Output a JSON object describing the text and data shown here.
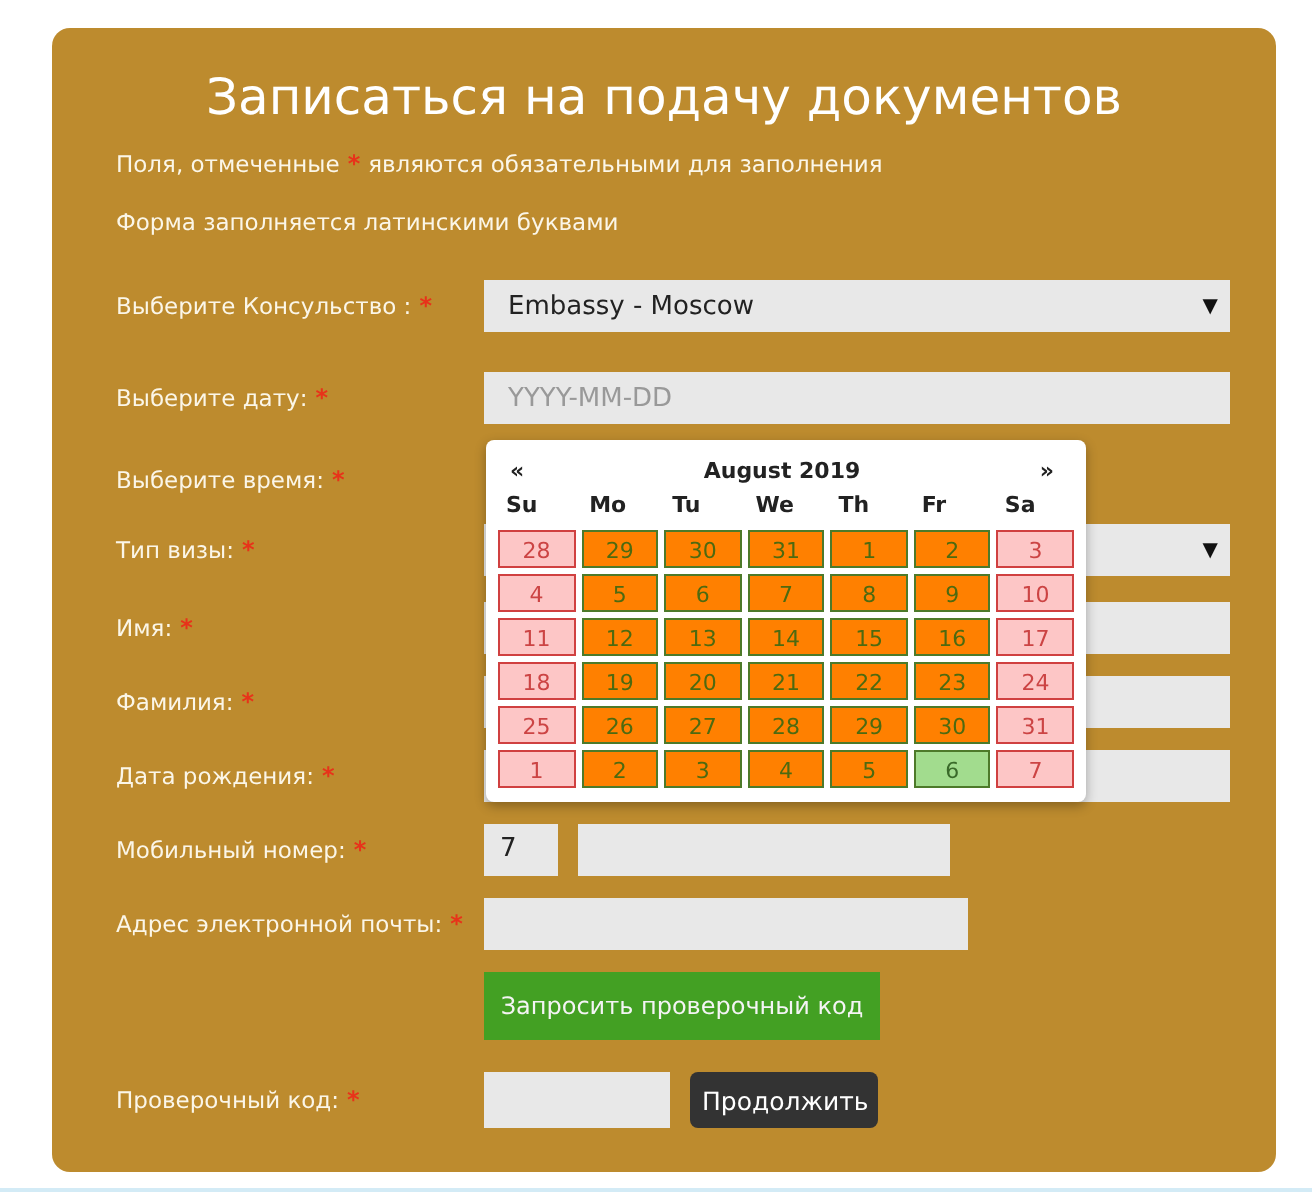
{
  "title": "Записаться на подачу документов",
  "required_mark": "*",
  "notes": [
    {
      "before": "Поля, отмеченные",
      "required": true,
      "after": "являются обязательными для заполнения"
    },
    {
      "before": "Форма заполняется латинскими буквами",
      "required": false
    }
  ],
  "fields": [
    {
      "label": "Выберите Консульство :",
      "required": true,
      "kind": "select",
      "value": "Embassy - Moscow",
      "arrow": "▼"
    },
    {
      "label": "Выберите дату:",
      "required": true,
      "kind": "date",
      "placeholder": "YYYY-MM-DD"
    },
    {
      "label": "Выберите время:",
      "required": true,
      "kind": "covered"
    },
    {
      "label": "Тип визы:",
      "required": true,
      "kind": "select",
      "arrow": "▼"
    },
    {
      "label": "Имя:",
      "required": true,
      "kind": "text"
    },
    {
      "label": "Фамилия:",
      "required": true,
      "kind": "text"
    },
    {
      "label": "Дата рождения:",
      "required": true,
      "kind": "text"
    },
    {
      "label": "Мобильный номер:",
      "required": true,
      "kind": "phone",
      "prefix": "7"
    },
    {
      "label": "Адрес электронной почты:",
      "required": true,
      "kind": "email"
    }
  ],
  "request_button": "Запросить проверочный код",
  "code": {
    "label": "Проверочный код:",
    "required": true
  },
  "continue_button": "Продолжить",
  "calendar": {
    "prev": "«",
    "title": "August 2019",
    "next": "»",
    "weekdays": [
      "Su",
      "Mo",
      "Tu",
      "We",
      "Th",
      "Fr",
      "Sa"
    ],
    "weeks": [
      [
        {
          "day": "28",
          "kind": "closed"
        },
        {
          "day": "29",
          "kind": "open"
        },
        {
          "day": "30",
          "kind": "open"
        },
        {
          "day": "31",
          "kind": "open"
        },
        {
          "day": "1",
          "kind": "open"
        },
        {
          "day": "2",
          "kind": "open"
        },
        {
          "day": "3",
          "kind": "closed"
        }
      ],
      [
        {
          "day": "4",
          "kind": "closed"
        },
        {
          "day": "5",
          "kind": "open"
        },
        {
          "day": "6",
          "kind": "open"
        },
        {
          "day": "7",
          "kind": "open"
        },
        {
          "day": "8",
          "kind": "open"
        },
        {
          "day": "9",
          "kind": "open"
        },
        {
          "day": "10",
          "kind": "closed"
        }
      ],
      [
        {
          "day": "11",
          "kind": "closed"
        },
        {
          "day": "12",
          "kind": "open"
        },
        {
          "day": "13",
          "kind": "open"
        },
        {
          "day": "14",
          "kind": "open"
        },
        {
          "day": "15",
          "kind": "open"
        },
        {
          "day": "16",
          "kind": "open"
        },
        {
          "day": "17",
          "kind": "closed"
        }
      ],
      [
        {
          "day": "18",
          "kind": "closed"
        },
        {
          "day": "19",
          "kind": "open"
        },
        {
          "day": "20",
          "kind": "open"
        },
        {
          "day": "21",
          "kind": "open"
        },
        {
          "day": "22",
          "kind": "open"
        },
        {
          "day": "23",
          "kind": "open"
        },
        {
          "day": "24",
          "kind": "closed"
        }
      ],
      [
        {
          "day": "25",
          "kind": "closed"
        },
        {
          "day": "26",
          "kind": "open"
        },
        {
          "day": "27",
          "kind": "open"
        },
        {
          "day": "28",
          "kind": "open"
        },
        {
          "day": "29",
          "kind": "open"
        },
        {
          "day": "30",
          "kind": "open"
        },
        {
          "day": "31",
          "kind": "closed"
        }
      ],
      [
        {
          "day": "1",
          "kind": "closed"
        },
        {
          "day": "2",
          "kind": "open"
        },
        {
          "day": "3",
          "kind": "open"
        },
        {
          "day": "4",
          "kind": "open"
        },
        {
          "day": "5",
          "kind": "open"
        },
        {
          "day": "6",
          "kind": "free"
        },
        {
          "day": "7",
          "kind": "closed"
        }
      ]
    ]
  }
}
